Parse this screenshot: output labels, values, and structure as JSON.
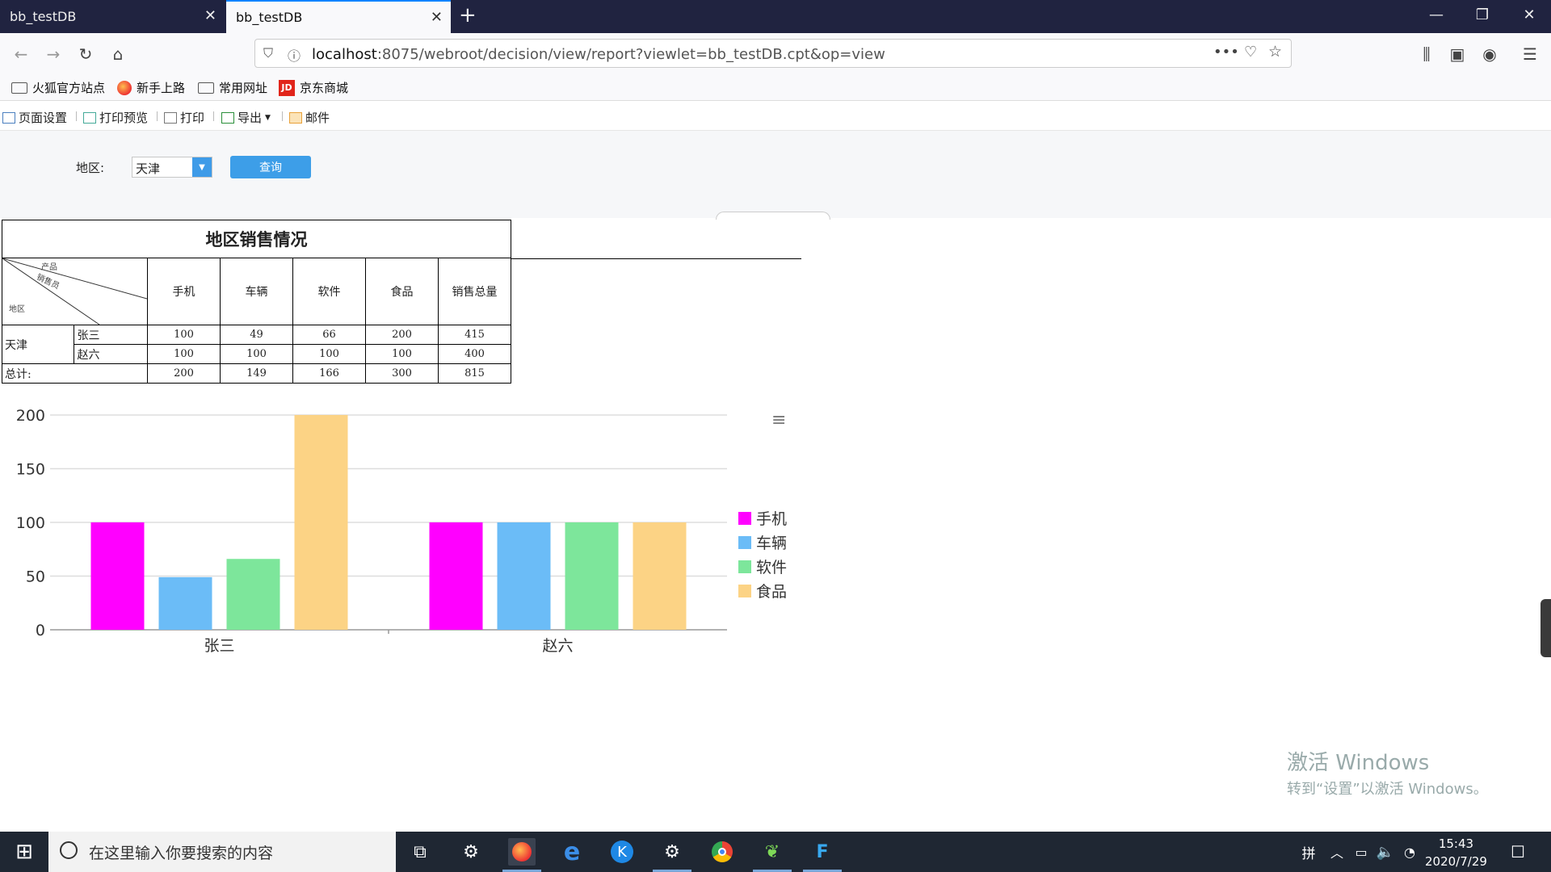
{
  "browser": {
    "tabs": [
      {
        "title": "bb_testDB"
      },
      {
        "title": "bb_testDB"
      }
    ],
    "url_host": "localhost",
    "url_rest": ":8075/webroot/decision/view/report?viewlet=bb_testDB.cpt&op=view"
  },
  "bookmarks": [
    {
      "label": "火狐官方站点",
      "icon": "folder-icon"
    },
    {
      "label": "新手上路",
      "icon": "firefox-icon"
    },
    {
      "label": "常用网址",
      "icon": "folder-icon"
    },
    {
      "label": "京东商城",
      "icon": "jd-icon",
      "badge": "JD"
    }
  ],
  "report_toolbar": {
    "page_setup": "页面设置",
    "print_preview": "打印预览",
    "print": "打印",
    "export": "导出",
    "mail": "邮件"
  },
  "params": {
    "region_label": "地区:",
    "region_value": "天津",
    "query_label": "查询"
  },
  "report": {
    "title": "地区销售情况",
    "corner": {
      "top": "产品",
      "mid": "销售员",
      "bottom": "地区"
    },
    "columns": [
      "手机",
      "车辆",
      "软件",
      "食品",
      "销售总量"
    ],
    "region": "天津",
    "rows": [
      {
        "name": "张三",
        "values": [
          "100",
          "49",
          "66",
          "200",
          "415"
        ]
      },
      {
        "name": "赵六",
        "values": [
          "100",
          "100",
          "100",
          "100",
          "400"
        ]
      }
    ],
    "total_label": "总计:",
    "totals": [
      "200",
      "149",
      "166",
      "300",
      "815"
    ]
  },
  "chart_data": {
    "type": "bar",
    "categories": [
      "张三",
      "赵六"
    ],
    "series": [
      {
        "name": "手机",
        "values": [
          100,
          100
        ],
        "color": "#ff00ff"
      },
      {
        "name": "车辆",
        "values": [
          49,
          100
        ],
        "color": "#6bbcf7"
      },
      {
        "name": "软件",
        "values": [
          66,
          100
        ],
        "color": "#7de69b"
      },
      {
        "name": "食品",
        "values": [
          200,
          100
        ],
        "color": "#fcd385"
      }
    ],
    "ylim": [
      0,
      200
    ],
    "yticks": [
      0,
      50,
      100,
      150,
      200
    ],
    "grid": true,
    "legend": "right"
  },
  "watermark": {
    "line1": "激活 Windows",
    "line2": "转到“设置”以激活 Windows。"
  },
  "taskbar": {
    "search_placeholder": "在这里输入你要搜索的内容",
    "time": "15:43",
    "date": "2020/7/29",
    "ime": "拼"
  }
}
